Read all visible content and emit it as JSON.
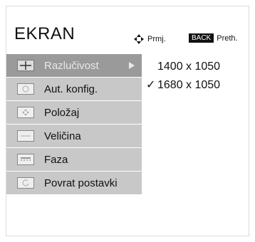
{
  "header": {
    "title": "EKRAN",
    "move_hint": "Prmj.",
    "back_key": "BACK",
    "back_hint": "Preth."
  },
  "menu": {
    "items": [
      {
        "label": "Razlučivost",
        "icon": "cross-box-icon",
        "selected": true
      },
      {
        "label": "Aut. konfig.",
        "icon": "auto-config-icon",
        "selected": false
      },
      {
        "label": "Položaj",
        "icon": "position-icon",
        "selected": false
      },
      {
        "label": "Veličina",
        "icon": "size-icon",
        "selected": false
      },
      {
        "label": "Faza",
        "icon": "phase-icon",
        "selected": false
      },
      {
        "label": "Povrat postavki",
        "icon": "reset-icon",
        "selected": false
      }
    ]
  },
  "resolution_options": [
    {
      "label": "1400 x 1050",
      "checked": false
    },
    {
      "label": "1680 x 1050",
      "checked": true
    }
  ]
}
